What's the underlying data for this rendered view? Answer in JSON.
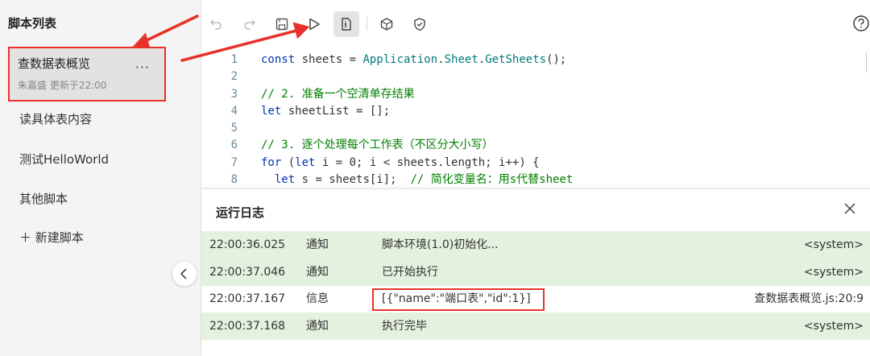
{
  "sidebar": {
    "title": "脚本列表",
    "active_script": {
      "name": "查数据表概览",
      "meta": "朱嘉盛 更新于22:00",
      "more": "···"
    },
    "scripts": [
      "读具体表内容",
      "测试HelloWorld",
      "其他脚本"
    ],
    "new_script": "＋ 新建脚本"
  },
  "toolbar": {
    "icons": [
      "undo-icon",
      "redo-icon",
      "save-icon",
      "run-icon",
      "debug-icon",
      "package-icon",
      "shield-icon",
      "help-icon"
    ]
  },
  "editor": {
    "lines": [
      {
        "n": "1",
        "text": "const sheets = Application.Sheet.GetSheets();"
      },
      {
        "n": "2",
        "text": ""
      },
      {
        "n": "3",
        "text": "// 2. 准备一个空清单存结果"
      },
      {
        "n": "4",
        "text": "let sheetList = [];"
      },
      {
        "n": "5",
        "text": ""
      },
      {
        "n": "6",
        "text": "// 3. 逐个处理每个工作表（不区分大小写）"
      },
      {
        "n": "7",
        "text": "for (let i = 0; i < sheets.length; i++) {"
      },
      {
        "n": "8",
        "text": "  let s = sheets[i];  // 简化变量名：用s代替sheet"
      }
    ]
  },
  "log": {
    "title": "运行日志",
    "rows": [
      {
        "time": "22:00:36.025",
        "level": "通知",
        "msg": "脚本环境(1.0)初始化...",
        "src": "<system>",
        "status": "ok"
      },
      {
        "time": "22:00:37.046",
        "level": "通知",
        "msg": "已开始执行",
        "src": "<system>",
        "status": "ok"
      },
      {
        "time": "22:00:37.167",
        "level": "信息",
        "msg": "[{\"name\":\"端口表\",\"id\":1}]",
        "src": "查数据表概览.js:20:9",
        "status": "info"
      },
      {
        "time": "22:00:37.168",
        "level": "通知",
        "msg": "执行完毕",
        "src": "<system>",
        "status": "ok"
      }
    ]
  },
  "colors": {
    "highlight": "#e8322b",
    "ok_row": "#e3f1de",
    "keyword": "#0033b3",
    "comment": "#008000"
  }
}
